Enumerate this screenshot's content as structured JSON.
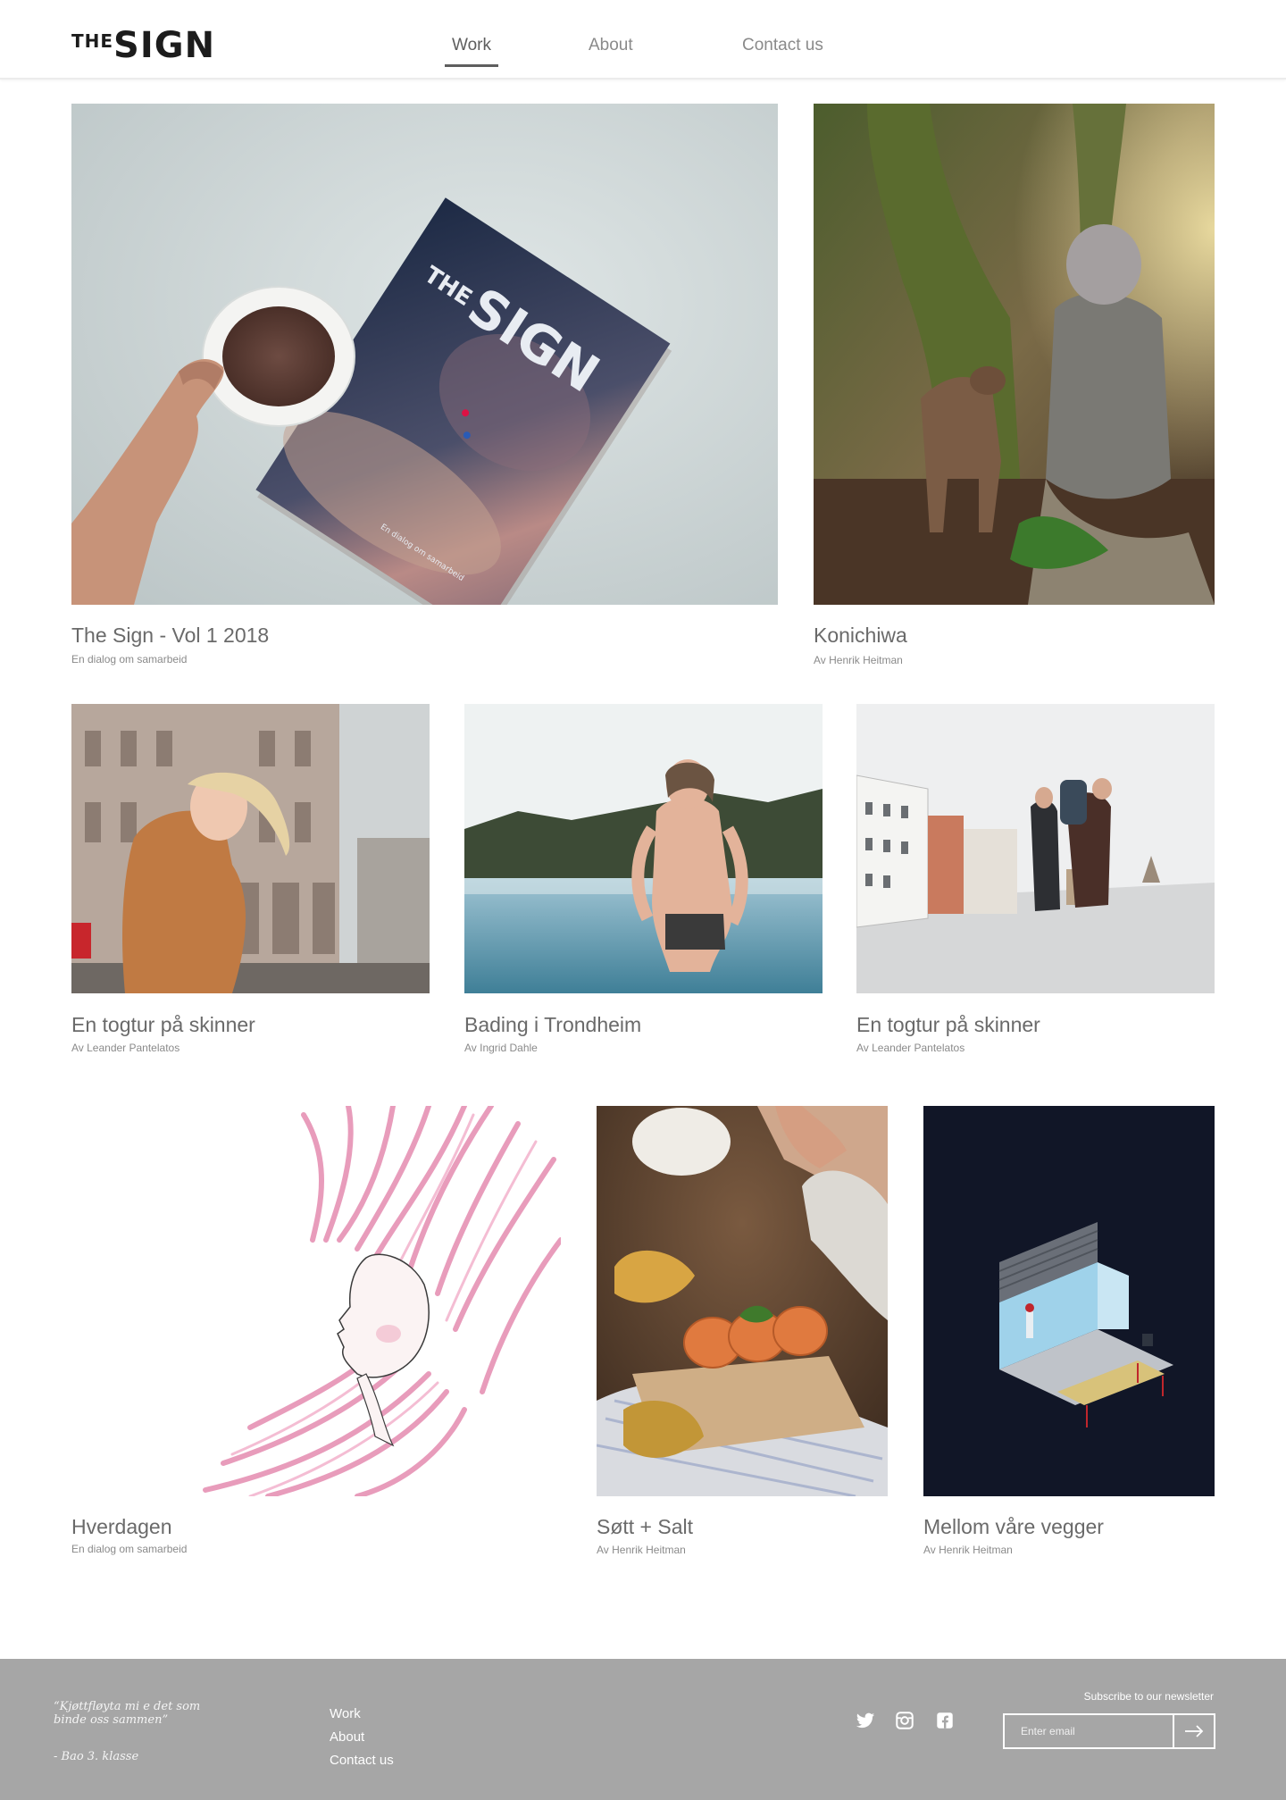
{
  "header": {
    "logo_the": "THE",
    "logo_sign": "SIGN",
    "nav": [
      "Work",
      "About",
      "Contact us"
    ],
    "active_nav": "Work"
  },
  "cards": [
    {
      "title": "The Sign - Vol 1 2018",
      "subtitle": "En dialog om samarbeid",
      "image": "magazine-and-coffee-photo",
      "magazine_title": "SIGN",
      "magazine_the": "THE",
      "magazine_tagline": "En dialog om samarbeid"
    },
    {
      "title": "Konichiwa",
      "subtitle": "Av Henrik Heitman",
      "image": "man-feeding-deer-photo"
    },
    {
      "title": "En togtur på skinner",
      "subtitle": "Av Leander Pantelatos",
      "image": "girl-in-city-photo"
    },
    {
      "title": "Bading i Trondheim",
      "subtitle": "Av Ingrid Dahle",
      "image": "man-swimming-photo"
    },
    {
      "title": "En togtur på skinner",
      "subtitle": "Av Leander Pantelatos",
      "image": "travellers-in-street-photo"
    },
    {
      "title": "Hverdagen",
      "subtitle": "En dialog om samarbeid",
      "image": "pink-hair-illustration"
    },
    {
      "title": "Søtt + Salt",
      "subtitle": "Av Henrik Heitman",
      "image": "food-photo"
    },
    {
      "title": "Mellom våre vegger",
      "subtitle": "Av Henrik Heitman",
      "image": "isometric-room-illustration"
    }
  ],
  "footer": {
    "quote": "“Kjøttfløyta mi e det som binde oss sammen”",
    "quote_author": "- Bao 3. klasse",
    "links": [
      "Work",
      "About",
      "Contact us"
    ],
    "social": [
      "twitter-icon",
      "instagram-icon",
      "facebook-icon"
    ],
    "subscribe_label": "Subscribe to our newsletter",
    "email_placeholder": "Enter email"
  }
}
